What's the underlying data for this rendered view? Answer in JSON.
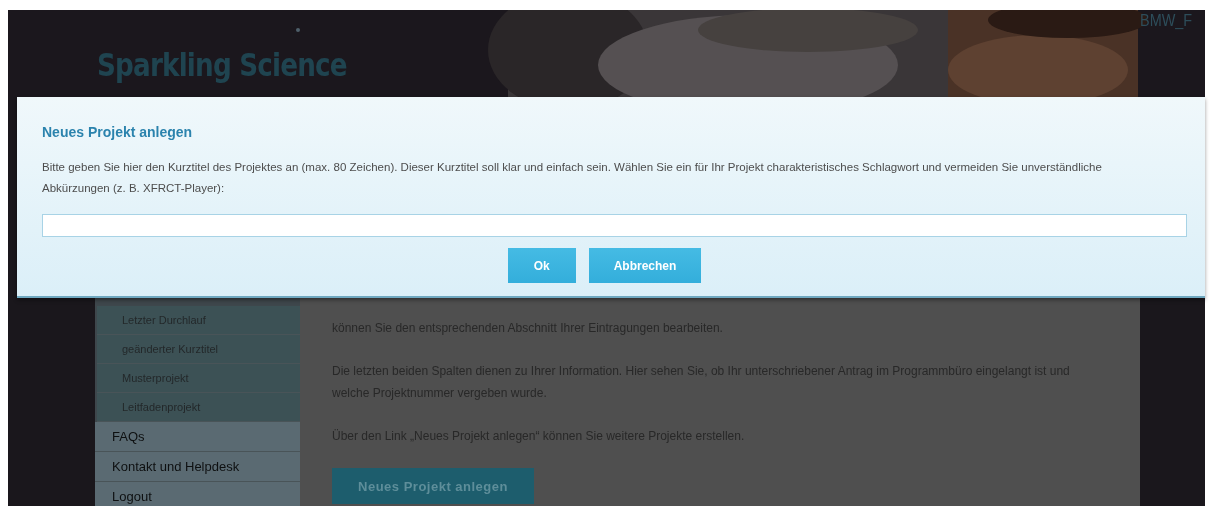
{
  "header": {
    "title": "Sparkling Science",
    "logo_text": "BMW_F"
  },
  "sidebar": {
    "items": [
      {
        "label": "Letzter Durchlauf",
        "kind": "sub"
      },
      {
        "label": "geänderter Kurztitel",
        "kind": "sub"
      },
      {
        "label": "Musterprojekt",
        "kind": "sub"
      },
      {
        "label": "Leitfadenprojekt",
        "kind": "sub"
      },
      {
        "label": "FAQs",
        "kind": "main"
      },
      {
        "label": "Kontakt und Helpdesk",
        "kind": "main"
      },
      {
        "label": "Logout",
        "kind": "main"
      }
    ]
  },
  "content": {
    "paragraphs": [
      "können Sie den entsprechenden Abschnitt Ihrer Eintragungen bearbeiten.",
      "Die letzten beiden Spalten dienen zu Ihrer Information. Hier sehen Sie, ob Ihr unterschriebener Antrag im Programmbüro eingelangt ist und welche Projektnummer vergeben wurde.",
      "Über den Link „Neues Projekt anlegen“ können Sie weitere Projekte erstellen."
    ],
    "button": "Neues Projekt anlegen"
  },
  "dialog": {
    "title": "Neues Projekt anlegen",
    "description": "Bitte geben Sie hier den Kurztitel des Projektes an (max. 80 Zeichen). Dieser Kurztitel soll klar und einfach sein. Wählen Sie ein für Ihr Projekt charakteristisches Schlagwort und vermeiden Sie unverständliche Abkürzungen (z. B. XFRCT-Player):",
    "field": {
      "kind": "text"
    },
    "buttons": [
      "Ok",
      "Abbrechen"
    ]
  }
}
